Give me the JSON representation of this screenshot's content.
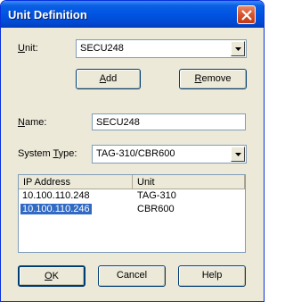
{
  "window": {
    "title": "Unit Definition"
  },
  "unit": {
    "label_prefix": "",
    "label_accel": "U",
    "label_rest": "nit:",
    "value": "SECU248"
  },
  "buttons": {
    "add_accel": "A",
    "add_rest": "dd",
    "remove_accel": "R",
    "remove_rest": "emove",
    "ok_accel": "O",
    "ok_rest": "K",
    "cancel": "Cancel",
    "help": "Help"
  },
  "name": {
    "label_accel": "N",
    "label_rest": "ame:",
    "value": "SECU248"
  },
  "system_type": {
    "label_prefix": "System ",
    "label_accel": "T",
    "label_rest": "ype:",
    "value": "TAG-310/CBR600"
  },
  "table": {
    "headers": [
      "IP Address",
      "Unit"
    ],
    "rows": [
      {
        "ip": "10.100.110.248",
        "unit": "TAG-310"
      },
      {
        "ip": "10.100.110.246",
        "unit": "CBR600"
      }
    ]
  }
}
